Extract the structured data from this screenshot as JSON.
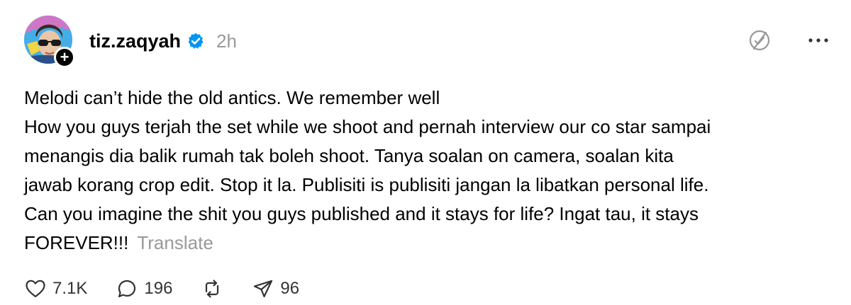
{
  "post": {
    "author": {
      "username": "tiz.zaqyah",
      "verified": true
    },
    "timestamp": "2h",
    "body_lines": [
      "Melodi can’t hide the old antics. We remember well",
      "How you guys terjah the set while we shoot and pernah interview our co star sampai",
      "menangis dia balik rumah tak boleh shoot. Tanya soalan on camera, soalan kita",
      "jawab korang crop edit. Stop it la. Publisiti is publisiti jangan la libatkan personal life.",
      "Can you imagine the shit you guys published and it stays for life? Ingat tau, it stays",
      "FOREVER!!!"
    ],
    "translate_label": "Translate",
    "stats": {
      "likes": "7.1K",
      "replies": "196",
      "shares": "96"
    }
  },
  "colors": {
    "verified_blue": "#0095f6",
    "muted_text": "#999999",
    "icon_gray": "#999999"
  },
  "icons": {
    "follow": "plus-icon",
    "verified": "verified-badge-icon",
    "no_reply": "no-reply-icon",
    "more": "more-horizontal-icon",
    "like": "heart-icon",
    "reply": "comment-icon",
    "repost": "repost-icon",
    "share": "send-icon"
  }
}
